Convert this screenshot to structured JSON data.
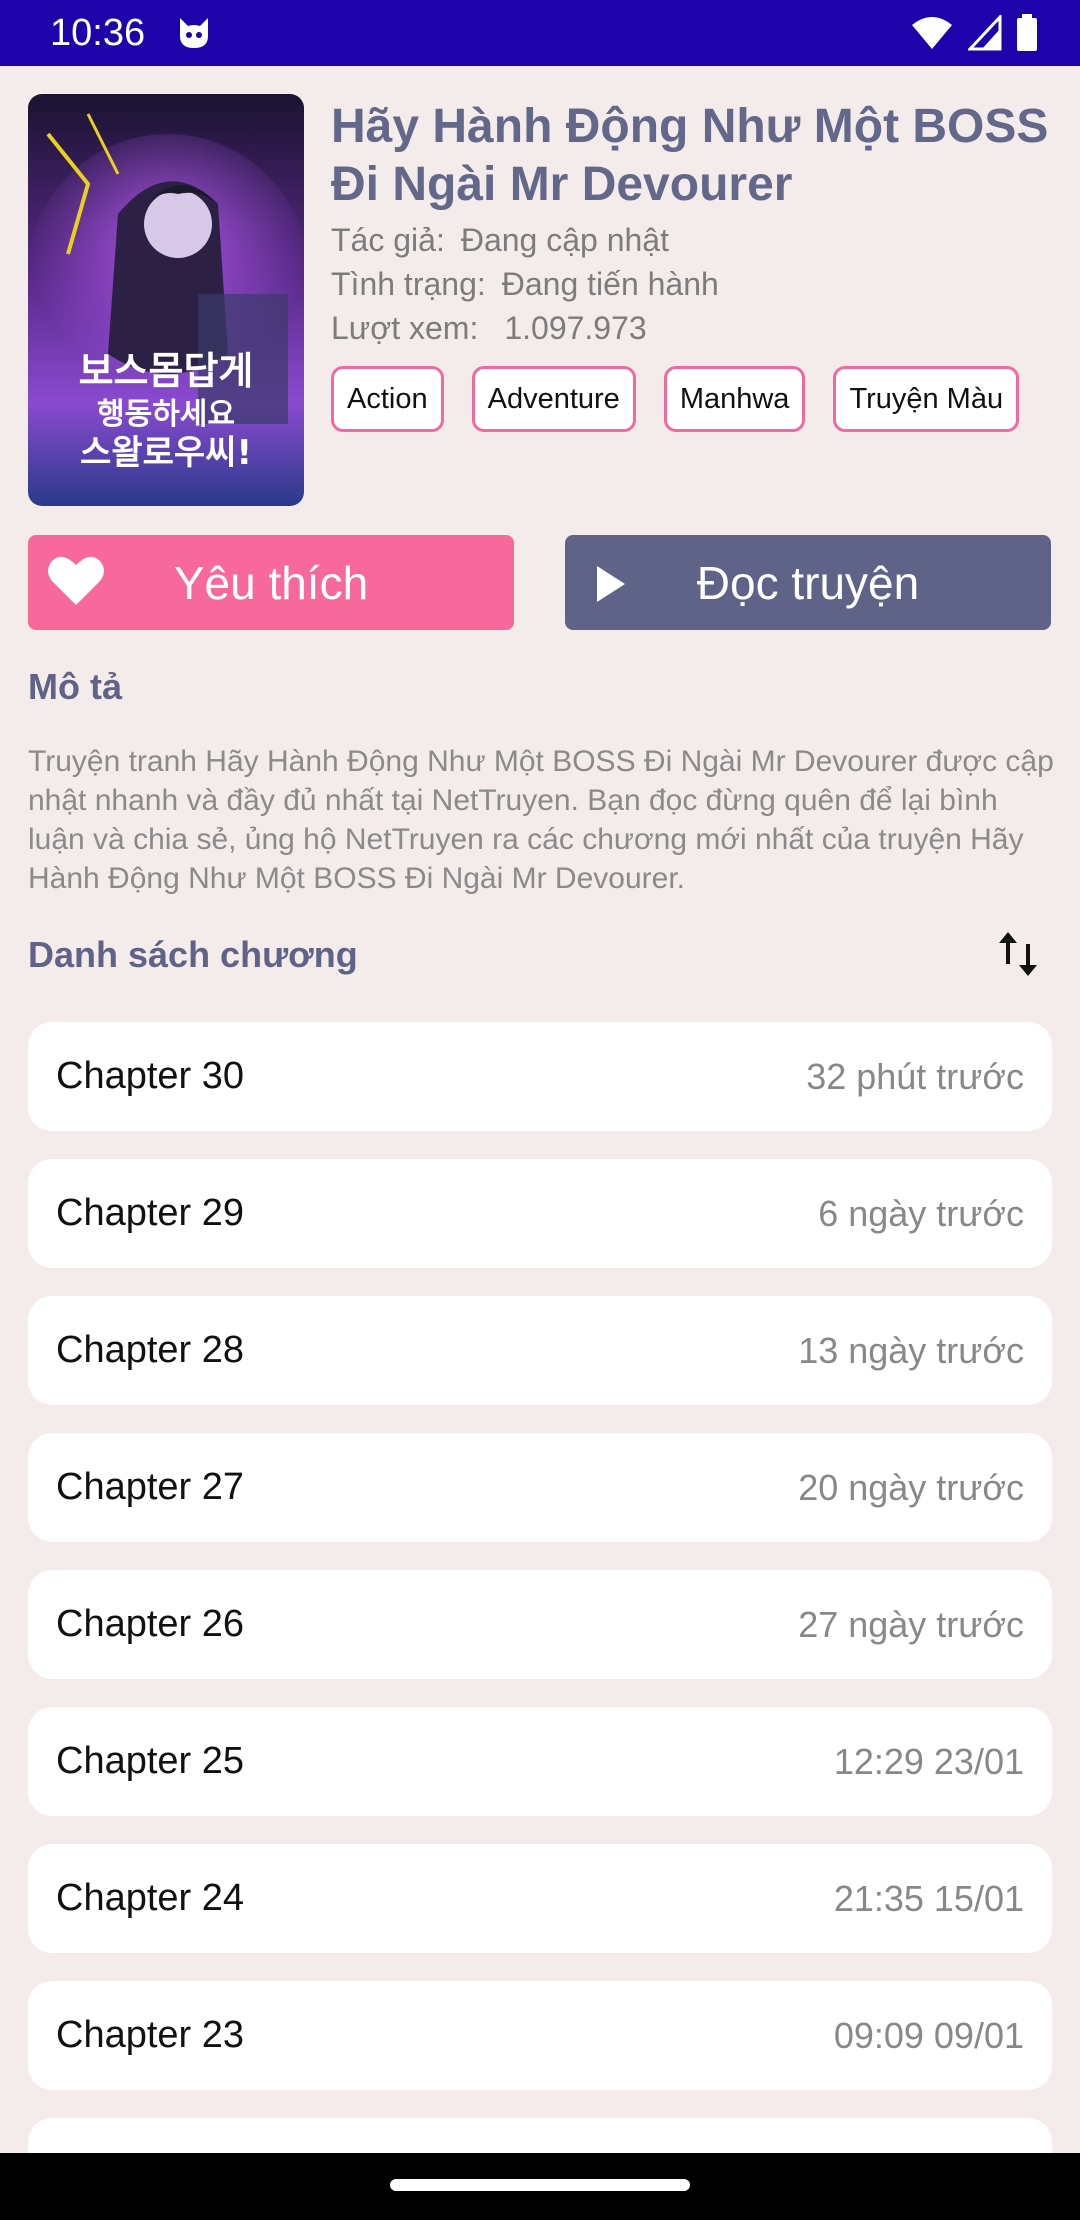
{
  "status_bar": {
    "time": "10:36",
    "icons": [
      "cat-notification-icon",
      "wifi-icon",
      "signal-icon",
      "battery-icon"
    ]
  },
  "comic": {
    "title": "Hãy Hành Động Như Một BOSS Đi Ngài Mr Devourer",
    "author_label": "Tác giả:",
    "author_value": "Đang cập nhật",
    "status_label": "Tình trạng:",
    "status_value": "Đang tiến hành",
    "views_label": "Lượt xem:",
    "views_value": "1.097.973",
    "tags": [
      "Action",
      "Adventure",
      "Manhwa",
      "Truyện Màu"
    ],
    "cover_text": "보스몸답게 행동하세요 스왈로우씨!"
  },
  "actions": {
    "favorite_label": "Yêu thích",
    "read_label": "Đọc truyện"
  },
  "description": {
    "heading": "Mô tả",
    "text": "Truyện tranh Hãy Hành Động Như Một BOSS Đi Ngài Mr Devourer được cập nhật nhanh và đầy đủ nhất tại NetTruyen. Bạn đọc đừng quên để lại bình luận và chia sẻ, ủng hộ NetTruyen ra các chương mới nhất của truyện Hãy Hành Động Như Một BOSS Đi Ngài Mr Devourer."
  },
  "chapters": {
    "heading": "Danh sách chương",
    "items": [
      {
        "name": "Chapter 30",
        "time": "32 phút trước"
      },
      {
        "name": "Chapter 29",
        "time": "6 ngày trước"
      },
      {
        "name": "Chapter 28",
        "time": "13 ngày trước"
      },
      {
        "name": "Chapter 27",
        "time": "20 ngày trước"
      },
      {
        "name": "Chapter 26",
        "time": "27 ngày trước"
      },
      {
        "name": "Chapter 25",
        "time": "12:29 23/01"
      },
      {
        "name": "Chapter 24",
        "time": "21:35 15/01"
      },
      {
        "name": "Chapter 23",
        "time": "09:09 09/01"
      },
      {
        "name": "",
        "time": ""
      }
    ]
  },
  "colors": {
    "status_bar": "#1e02aa",
    "favorite": "#f7699b",
    "read": "#5f6387",
    "tag_border": "#f06aa0",
    "background": "#f4ecea"
  }
}
